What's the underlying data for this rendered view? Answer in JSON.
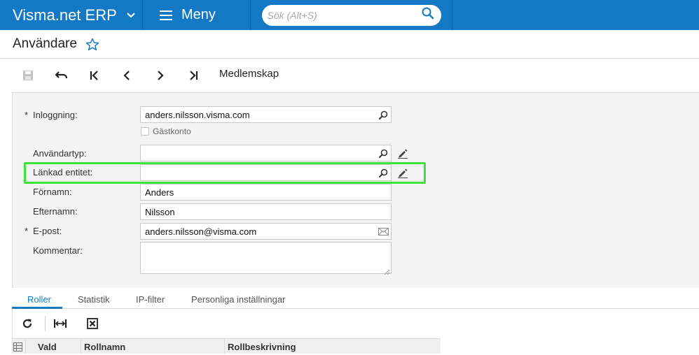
{
  "topbar": {
    "brand": "Visma.net ERP",
    "menu_label": "Meny",
    "search_placeholder": "Sök (Alt+S)"
  },
  "page": {
    "title": "Användare"
  },
  "toolbar": {
    "membership_label": "Medlemskap"
  },
  "form": {
    "login": {
      "label": "Inloggning:",
      "required": "*",
      "value": "anders.nilsson.visma.com"
    },
    "guest_account": {
      "label": "Gästkonto",
      "checked": false
    },
    "user_type": {
      "label": "Användartyp:",
      "value": ""
    },
    "linked_entity": {
      "label": "Länkad entitet:",
      "value": ""
    },
    "first_name": {
      "label": "Förnamn:",
      "value": "Anders"
    },
    "last_name": {
      "label": "Efternamn:",
      "value": "Nilsson"
    },
    "email": {
      "label": "E-post:",
      "required": "*",
      "value": "anders.nilsson@visma.com"
    },
    "comment": {
      "label": "Kommentar:",
      "value": ""
    }
  },
  "tabs": [
    {
      "label": "Roller",
      "active": true
    },
    {
      "label": "Statistik",
      "active": false
    },
    {
      "label": "IP-filter",
      "active": false
    },
    {
      "label": "Personliga inställningar",
      "active": false
    }
  ],
  "grid": {
    "columns": [
      "Vald",
      "Rollnamn",
      "Rollbeskrivning"
    ]
  },
  "colors": {
    "brand_blue": "#1479c4",
    "highlight_green": "#3fe23f"
  }
}
